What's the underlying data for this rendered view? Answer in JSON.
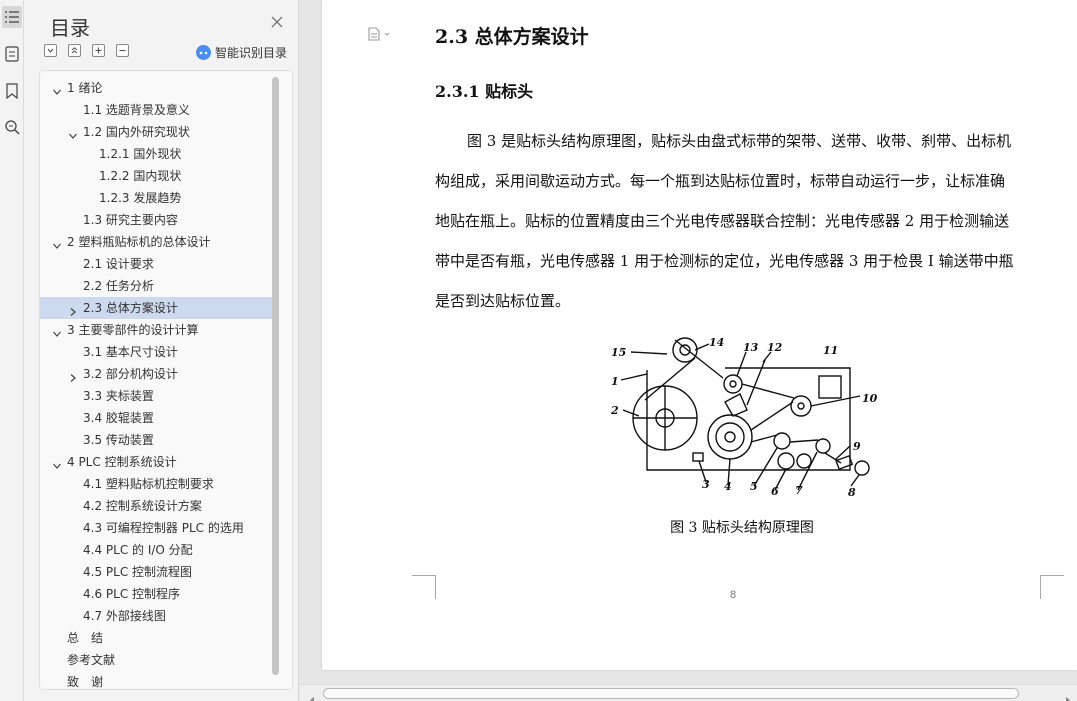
{
  "toc": {
    "title": "目录",
    "smart_toc_label": "智能识别目录",
    "items": [
      {
        "label": "1 绪论",
        "level": 1,
        "arrow": "down"
      },
      {
        "label": "1.1 选题背景及意义",
        "level": 2,
        "arrow": "none"
      },
      {
        "label": "1.2 国内外研究现状",
        "level": 2,
        "arrow": "down"
      },
      {
        "label": "1.2.1 国外现状",
        "level": 3,
        "arrow": "none"
      },
      {
        "label": "1.2.2 国内现状",
        "level": 3,
        "arrow": "none"
      },
      {
        "label": "1.2.3 发展趋势",
        "level": 3,
        "arrow": "none"
      },
      {
        "label": "1.3 研究主要内容",
        "level": 2,
        "arrow": "none"
      },
      {
        "label": "2 塑料瓶贴标机的总体设计",
        "level": 1,
        "arrow": "down"
      },
      {
        "label": "2.1 设计要求",
        "level": 2,
        "arrow": "none"
      },
      {
        "label": "2.2 任务分析",
        "level": 2,
        "arrow": "none"
      },
      {
        "label": "2.3 总体方案设计",
        "level": 2,
        "arrow": "right",
        "selected": true
      },
      {
        "label": "3 主要零部件的设计计算",
        "level": 1,
        "arrow": "down"
      },
      {
        "label": "3.1 基本尺寸设计",
        "level": 2,
        "arrow": "none"
      },
      {
        "label": "3.2 部分机构设计",
        "level": 2,
        "arrow": "right"
      },
      {
        "label": "3.3 夹标装置",
        "level": 2,
        "arrow": "none"
      },
      {
        "label": "3.4 胶辊装置",
        "level": 2,
        "arrow": "none"
      },
      {
        "label": "3.5 传动装置",
        "level": 2,
        "arrow": "none"
      },
      {
        "label": "4 PLC 控制系统设计",
        "level": 1,
        "arrow": "down"
      },
      {
        "label": "4.1 塑料贴标机控制要求",
        "level": 2,
        "arrow": "none"
      },
      {
        "label": "4.2 控制系统设计方案",
        "level": 2,
        "arrow": "none"
      },
      {
        "label": "4.3 可编程控制器 PLC 的选用",
        "level": 2,
        "arrow": "none"
      },
      {
        "label": "4.4 PLC 的 I/O 分配",
        "level": 2,
        "arrow": "none"
      },
      {
        "label": "4.5 PLC 控制流程图",
        "level": 2,
        "arrow": "none"
      },
      {
        "label": "4.6 PLC 控制程序",
        "level": 2,
        "arrow": "none"
      },
      {
        "label": "4.7 外部接线图",
        "level": 2,
        "arrow": "none"
      },
      {
        "label": "总　结",
        "level": 0,
        "arrow": "none"
      },
      {
        "label": "参考文献",
        "level": 0,
        "arrow": "none"
      },
      {
        "label": "致　谢",
        "level": 0,
        "arrow": "none"
      }
    ]
  },
  "document": {
    "heading2": "2.3 总体方案设计",
    "heading3": "2.3.1 贴标头",
    "paragraph_lines": [
      "图 3 是贴标头结构原理图，贴标头由盘式标带的架带、送带、收带、刹带、出标机",
      "构组成，采用间歇运动方式。每一个瓶到达贴标位置时，标带自动运行一步，让标准确",
      "地贴在瓶上。贴标的位置精度由三个光电传感器联合控制：光电传感器 2 用于检测输送",
      "带中是否有瓶，光电传感器 1 用于检测标的定位，光电传感器 3 用于检畏 I 输送带中瓶",
      "是否到达贴标位置。"
    ],
    "figure_labels": [
      "15",
      "14",
      "13",
      "12",
      "11",
      "1",
      "2",
      "10",
      "9",
      "3",
      "4",
      "5",
      "6",
      "7",
      "8"
    ],
    "figure_caption": "图 3 贴标头结构原理图",
    "page_number": "8"
  },
  "icons": {
    "rail": [
      "toc-list-icon",
      "document-outline-icon",
      "bookmark-icon",
      "search-zoom-icon"
    ],
    "toc_tools": [
      "collapse-all-icon",
      "expand-level-icon",
      "add-heading-icon",
      "remove-heading-icon"
    ]
  },
  "colors": {
    "selected_row": "#cdd9ef",
    "ai_icon": "#4a8ff0"
  }
}
